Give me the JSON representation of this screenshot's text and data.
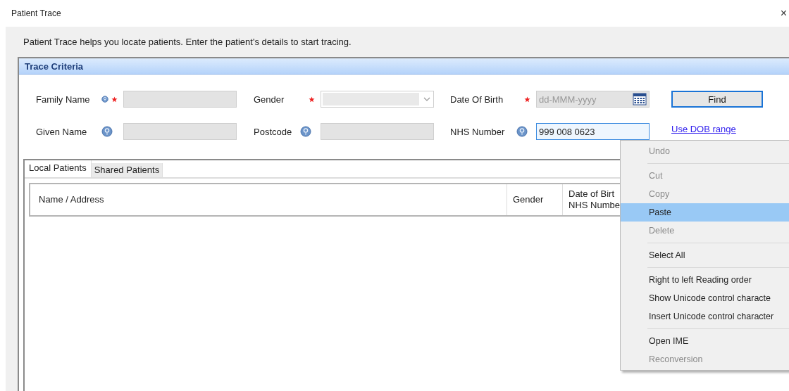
{
  "window": {
    "title": "Patient Trace",
    "close": "×"
  },
  "intro": "Patient Trace helps you locate patients.  Enter the patient's details to start tracing.",
  "criteria": {
    "title": "Trace Criteria",
    "rows": [
      {
        "fields": [
          {
            "kind": "text",
            "label": "Family Name",
            "help": true,
            "required": true,
            "focused": false
          },
          {
            "kind": "select",
            "label": "Gender",
            "help": false,
            "required": true,
            "focused": false
          },
          {
            "kind": "date",
            "label": "Date Of Birth",
            "help": false,
            "required": true,
            "placeholder": "dd-MMM-yyyy",
            "focused": false
          }
        ],
        "action": {
          "kind": "button",
          "label": "Find"
        }
      },
      {
        "fields": [
          {
            "kind": "text",
            "label": "Given Name",
            "help": true,
            "required": false,
            "focused": false
          },
          {
            "kind": "text",
            "label": "Postcode",
            "help": true,
            "required": false,
            "focused": false
          },
          {
            "kind": "text",
            "label": "NHS Number",
            "help": true,
            "required": false,
            "value": "999 008 0623",
            "focused": true
          }
        ],
        "action": {
          "kind": "link",
          "label": "Use DOB range"
        }
      }
    ]
  },
  "tabs": [
    {
      "label": "Local Patients",
      "selected": true
    },
    {
      "label": "Shared Patients",
      "selected": false
    }
  ],
  "table": {
    "columns": [
      {
        "lines": [
          "Name / Address"
        ]
      },
      {
        "lines": [
          "Gender"
        ]
      },
      {
        "lines": [
          "Date of Birt",
          "NHS Numbe"
        ]
      }
    ]
  },
  "context_menu": {
    "groups": [
      [
        {
          "label": "Undo",
          "disabled": true,
          "selected": false
        }
      ],
      [
        {
          "label": "Cut",
          "disabled": true,
          "selected": false
        },
        {
          "label": "Copy",
          "disabled": true,
          "selected": false
        },
        {
          "label": "Paste",
          "disabled": false,
          "selected": true
        },
        {
          "label": "Delete",
          "disabled": true,
          "selected": false
        }
      ],
      [
        {
          "label": "Select All",
          "disabled": false,
          "selected": false
        }
      ],
      [
        {
          "label": "Right to left Reading order",
          "disabled": false,
          "selected": false
        },
        {
          "label": "Show Unicode control characte",
          "disabled": false,
          "selected": false
        },
        {
          "label": "Insert Unicode control character",
          "disabled": false,
          "selected": false
        }
      ],
      [
        {
          "label": "Open IME",
          "disabled": false,
          "selected": false
        },
        {
          "label": "Reconversion",
          "disabled": true,
          "selected": false
        }
      ]
    ]
  }
}
